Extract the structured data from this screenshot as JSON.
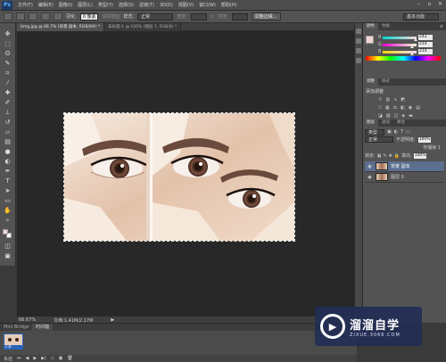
{
  "app": {
    "logo": "Ps"
  },
  "menu": [
    "文件(F)",
    "编辑(E)",
    "图像(I)",
    "图层(L)",
    "类型(Y)",
    "选择(S)",
    "滤镜(T)",
    "3D(D)",
    "视图(V)",
    "窗口(W)",
    "帮助(H)"
  ],
  "options": {
    "feather_label": "羽化:",
    "feather_value": "0 像素",
    "antialias_label": "消除锯齿",
    "style_label": "样式:",
    "style_value": "正常",
    "width_label": "宽度:",
    "height_label": "高度:",
    "refine_button": "调整边缘...",
    "workspace": "基本功能"
  },
  "document_tabs": [
    {
      "label": "timg.jpg @ 66.7% (背景 副本, RGB/8#) *",
      "active": true
    },
    {
      "label": "未标题-1 @ 100% (图层 1, RGB/8) *",
      "active": false
    }
  ],
  "status": {
    "zoom": "66.67%",
    "doc": "文档:1.41M/2.17M"
  },
  "timeline": {
    "tabs": [
      "Mini Bridge",
      "时间轴"
    ],
    "frame_time": "0 秒",
    "loop": "永远"
  },
  "color_panel": {
    "tabs": [
      "颜色",
      "色板"
    ],
    "r": "242",
    "g": "214",
    "b": "214"
  },
  "adjust_panel": {
    "tabs": [
      "调整",
      "样式"
    ],
    "title": "添加调整"
  },
  "layers_panel": {
    "tabs": [
      "图层",
      "通道",
      "路径"
    ],
    "kind": "类型",
    "blend": "正常",
    "opacity_label": "不透明度:",
    "opacity": "100%",
    "lock_label": "锁定:",
    "fill_label": "填充:",
    "fill": "100%",
    "unify_label": "传播帧 1",
    "layers": [
      {
        "name": "背景 副本",
        "selected": true
      },
      {
        "name": "图层 0",
        "selected": false
      }
    ]
  },
  "watermark": {
    "title": "溜溜自学",
    "url": "ZIXUE.3066.COM"
  },
  "colors": {
    "accent": "#2a64b8",
    "fg": "#f2d6d6",
    "bg": "#ffffff"
  }
}
